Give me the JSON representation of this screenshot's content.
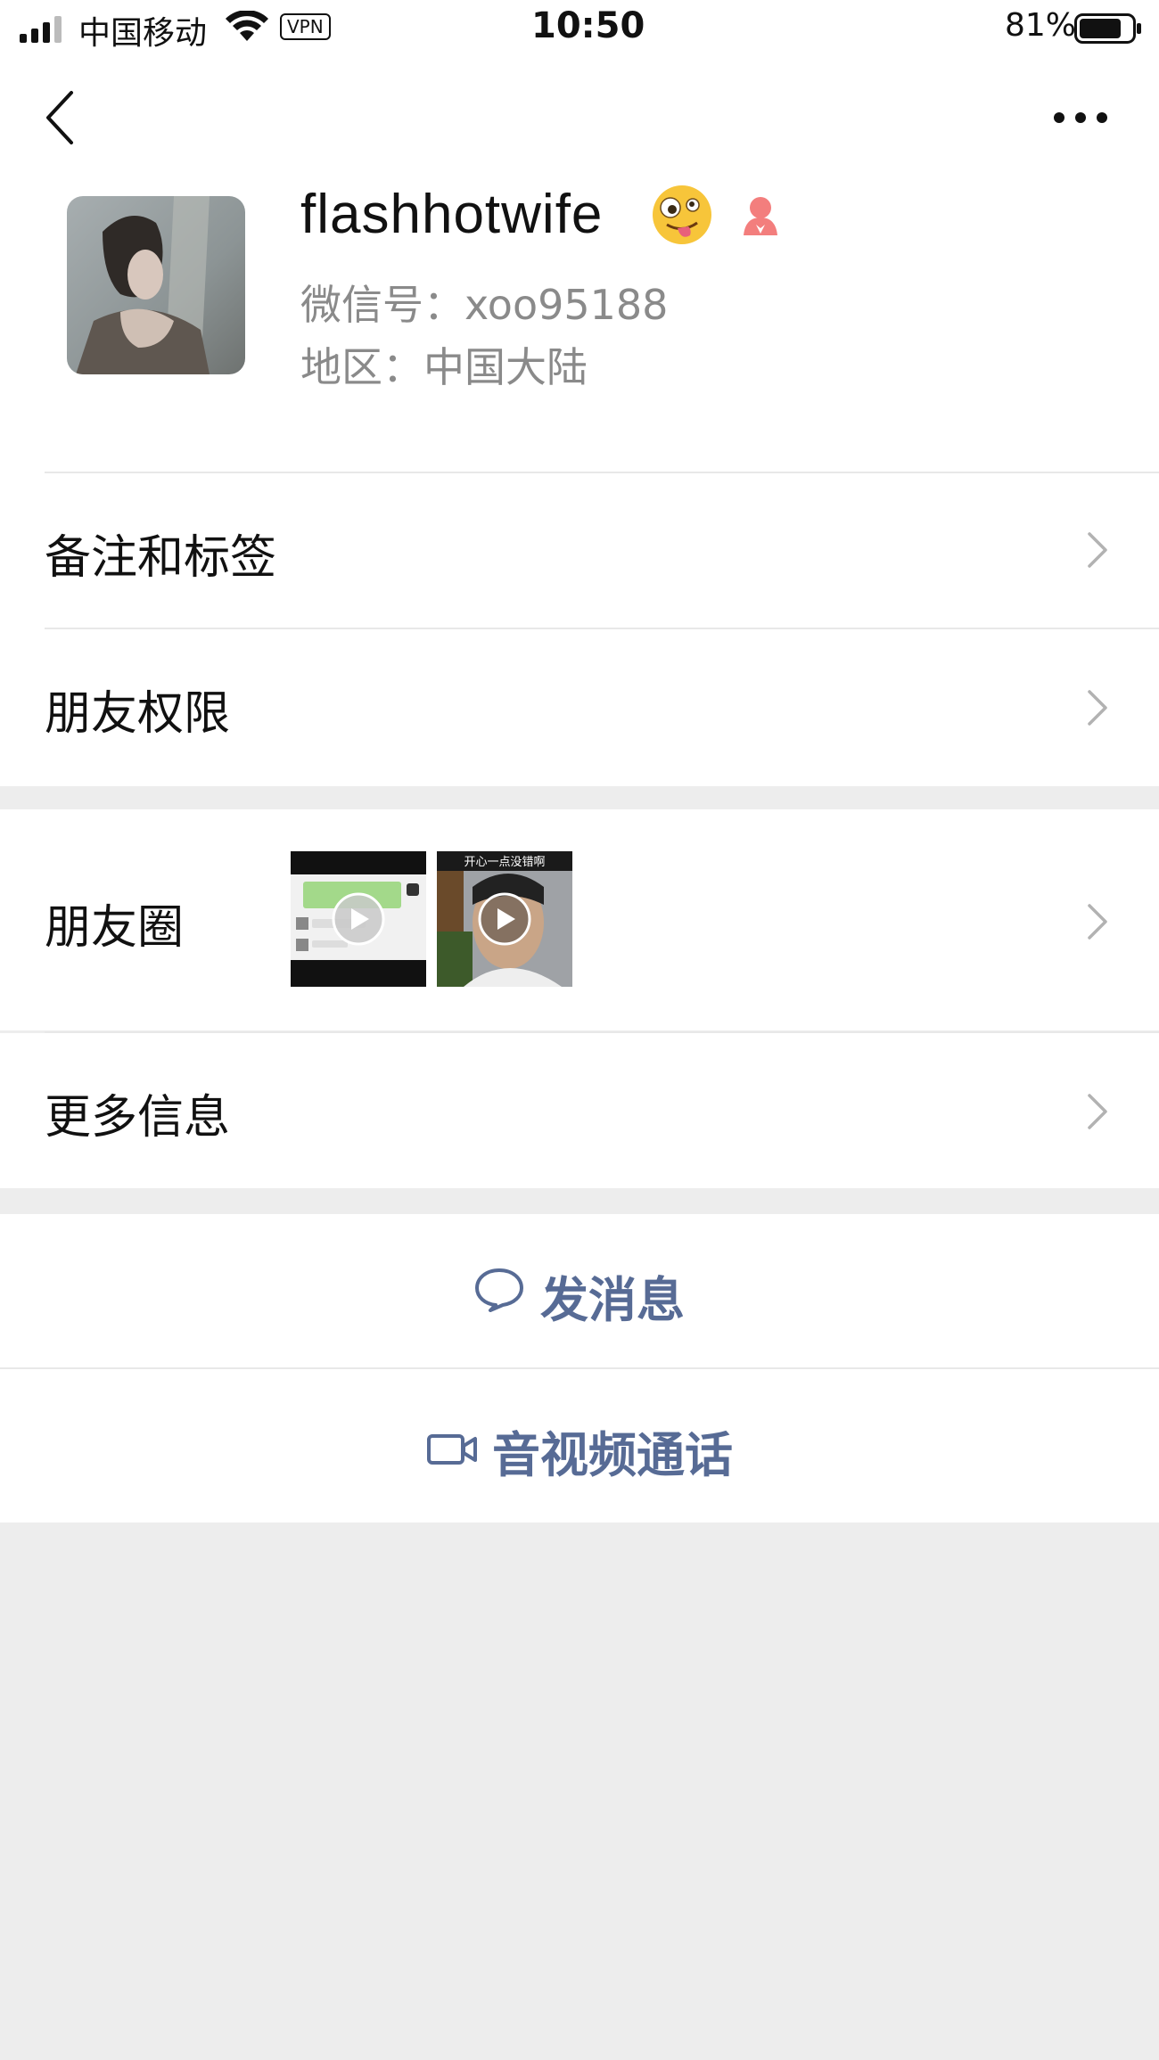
{
  "status_bar": {
    "carrier": "中国移动",
    "vpn": "VPN",
    "time": "10:50",
    "battery_pct": "81%",
    "battery_level": 0.81
  },
  "profile": {
    "nickname": "flashhotwife",
    "wechat_id": "微信号：xoo95188",
    "region": "地区：中国大陆"
  },
  "menu": {
    "remarks_tags": "备注和标签",
    "friend_permissions": "朋友权限",
    "moments": "朋友圈",
    "more_info": "更多信息"
  },
  "moments_thumbs": {
    "thumb2_caption": "开心一点没错啊"
  },
  "actions": {
    "send_message": "发消息",
    "video_call": "音视频通话"
  },
  "colors": {
    "link_blue": "#576b95",
    "background": "#ededed",
    "gender_female": "#f37e7d"
  }
}
